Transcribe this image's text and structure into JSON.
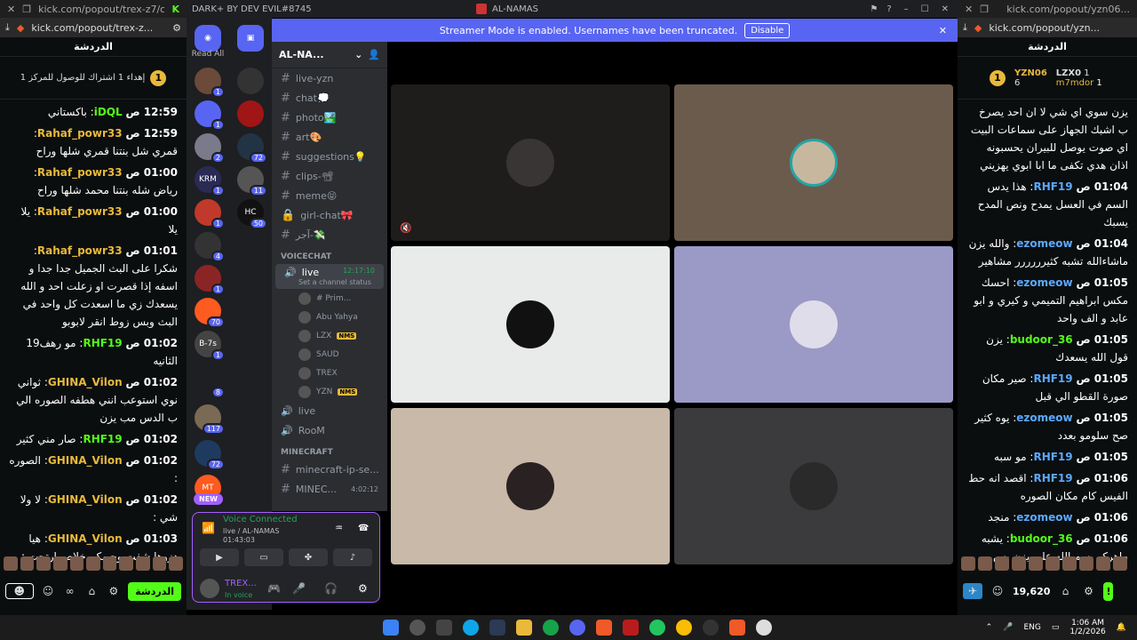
{
  "left_browser": {
    "tab_title": "kick.com/popout/trex-z7/c...",
    "url": "kick.com/popout/trex-z...",
    "chat_header": "الدردشة",
    "pinned_text": "إهداء 1 اشتراك للوصول للمركز 1",
    "pinned_rank": "1",
    "messages": [
      {
        "time": "12:59 ص",
        "user": "iDQL",
        "color": "#53fc18",
        "text": "باكستاني"
      },
      {
        "time": "12:59 ص",
        "user": "Rahaf_powr33",
        "color": "#e8b93b",
        "text": "قمري شل بنتنا قمري شلها وراح"
      },
      {
        "time": "01:00 ص",
        "user": "Rahaf_powr33",
        "color": "#e8b93b",
        "text": "رياض شله بنتنا محمد شلها وراح"
      },
      {
        "time": "01:00 ص",
        "user": "Rahaf_powr33",
        "color": "#e8b93b",
        "text": "يلا يلا"
      },
      {
        "time": "01:01 ص",
        "user": "Rahaf_powr33",
        "color": "#e8b93b",
        "text": "شكرا على البث الجميل جدا جدا و اسفه إذا قصرت او زعلت احد و الله يسعدك زي ما اسعدت كل واحد في البث وبس زوط انقر لابوبو"
      },
      {
        "time": "01:02 ص",
        "user": "RHF19",
        "color": "#53fc18",
        "text": "مو رهف19 الثانيه"
      },
      {
        "time": "01:02 ص",
        "user": "GHINA_Vilon",
        "color": "#e8b93b",
        "text": "ثواني نوي استوعب انني هطفه الصوره الي ب الدس مب يزن"
      },
      {
        "time": "01:02 ص",
        "user": "RHF19",
        "color": "#53fc18",
        "text": "صار مني كثير"
      },
      {
        "time": "01:02 ص",
        "user": "GHINA_Vilon",
        "color": "#e8b93b",
        "text": "الصوره :"
      },
      {
        "time": "01:02 ص",
        "user": "GHINA_Vilon",
        "color": "#e8b93b",
        "text": "لا ولا شي :"
      },
      {
        "time": "01:03 ص",
        "user": "GHINA_Vilon",
        "color": "#e8b93b",
        "text": "هيا دزوها شفت وجيهكم خلاص ارتحت :"
      }
    ],
    "send_label": "الدردشة",
    "infinity": "∞"
  },
  "right_browser": {
    "tab_title": "kick.com/popout/yzn06...",
    "url": "kick.com/popout/yzn...",
    "chat_header": "الدردشة",
    "top_users": [
      {
        "rank": "1",
        "name": "YZN06",
        "count": "6"
      },
      {
        "name": "LZX0",
        "count": "1"
      },
      {
        "name": "m7mdor",
        "count": "1"
      }
    ],
    "messages": [
      {
        "time": "",
        "user": "",
        "color": "#fff",
        "text": "يزن سوي اي شي لا ان احد يصرخ ب اشبك الجهاز على سماعات البيت اي صوت يوصل للبيران يحسبونه اذان هدي تكفى ما ابا ابوي يهزيني"
      },
      {
        "time": "01:04 ص",
        "user": "RHF19",
        "color": "#5aa9ff",
        "text": "هذا يدس السم في العسل يمدح ونص المدح يسبك"
      },
      {
        "time": "01:04 ص",
        "user": "ezomeow",
        "color": "#5aa9ff",
        "text": "والله يزن ماشاءالله تشبه كثيرررررر مشاهير"
      },
      {
        "time": "01:05 ص",
        "user": "ezomeow",
        "color": "#5aa9ff",
        "text": "احسك مكس ابراهيم التميمي و كيري و ابو عابد و الف واحد"
      },
      {
        "time": "01:05 ص",
        "user": "budoor_36",
        "color": "#53fc18",
        "text": "يزن قول الله يسعدك"
      },
      {
        "time": "01:05 ص",
        "user": "RHF19",
        "color": "#5aa9ff",
        "text": "صير مكان صورة القطو الي قبل"
      },
      {
        "time": "01:05 ص",
        "user": "ezomeow",
        "color": "#5aa9ff",
        "text": "يوه كثير صح سلومو بعدد"
      },
      {
        "time": "01:05 ص",
        "user": "RHF19",
        "color": "#5aa9ff",
        "text": "مو سبه"
      },
      {
        "time": "01:06 ص",
        "user": "RHF19",
        "color": "#5aa9ff",
        "text": "اقصد انه حط الفيس كام مكان الصوره"
      },
      {
        "time": "01:06 ص",
        "user": "ezomeow",
        "color": "#5aa9ff",
        "text": "منجد"
      },
      {
        "time": "01:06 ص",
        "user": "budoor_36",
        "color": "#53fc18",
        "text": "يشبه ماهركو بسم الله على يزن بس"
      }
    ],
    "points": "19,620"
  },
  "discord": {
    "title_left": "DARK+ BY DEV EVIL#8745",
    "title_center": "AL-NAMAS",
    "banner_text": "Streamer Mode is enabled. Usernames have been truncated.",
    "banner_button": "Disable",
    "read_all": "Read All",
    "server_name": "AL-NA...",
    "channels_top": [
      "live-yzn",
      "chat💭",
      "photo🏞️",
      "art🎨",
      "suggestions💡",
      "clips-📽",
      "meme😝",
      "girl-chat🎀",
      "آجر-💸"
    ],
    "voice_category": "VOICECHAT",
    "voice_channel": "live",
    "voice_time": "12:17:10",
    "voice_status": "Set a channel status",
    "voice_users": [
      "# Prim...",
      "Abu Yahya",
      "LZX",
      "SAUD",
      "TREX",
      "YZN"
    ],
    "nms": "NMS",
    "more_voice": [
      "live",
      "RooM"
    ],
    "mc_category": "MINECRAFT",
    "mc_channels": [
      "minecraft-ip-se...",
      "MINEC..."
    ],
    "mc_time": "4:02:12",
    "new_label": "NEW",
    "vc_title": "Voice Connected",
    "vc_sub": "live / AL-NAMAS",
    "vc_time": "01:43:03",
    "user_name": "TREX...",
    "user_status": "In voice",
    "server_badges": [
      "1",
      "1",
      "2",
      "1",
      "1",
      "4",
      "1",
      "70",
      "1",
      "8",
      "117",
      "72",
      "11",
      "50"
    ],
    "server_text": [
      "KRM",
      "B-7s",
      "MT",
      "HC"
    ]
  },
  "taskbar": {
    "time": "1:06 AM",
    "date": "1/2/2026",
    "lang": "ENG"
  }
}
